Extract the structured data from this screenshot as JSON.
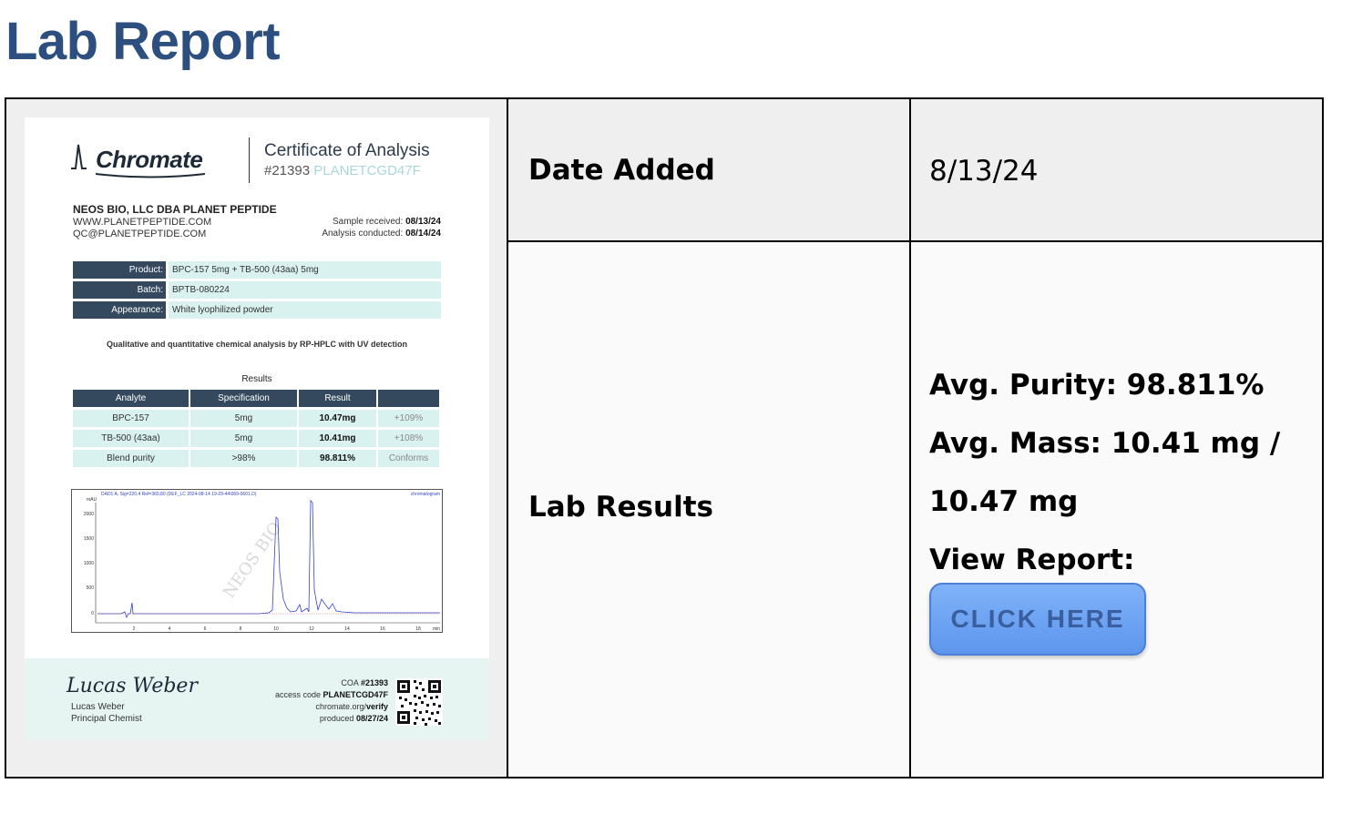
{
  "page": {
    "title": "Lab Report"
  },
  "table": {
    "date_added_label": "Date Added",
    "date_added_value": "8/13/24",
    "lab_results_label": "Lab Results",
    "avg_purity": "Avg. Purity: 98.811%",
    "avg_mass_line1": "Avg. Mass: 10.41 mg /",
    "avg_mass_line2": "10.47 mg",
    "view_report": "View Report:",
    "button_label": "CLICK HERE"
  },
  "coa": {
    "logo_text": "Chromate",
    "title": "Certificate of Analysis",
    "number": "#21393",
    "code": "PLANETCGD47F",
    "company": "NEOS BIO, LLC DBA PLANET PEPTIDE",
    "website": "WWW.PLANETPEPTIDE.COM",
    "email": "QC@PLANETPEPTIDE.COM",
    "received_label": "Sample received:",
    "received_date": "08/13/24",
    "conducted_label": "Analysis conducted:",
    "conducted_date": "08/14/24",
    "info": [
      {
        "key": "Product:",
        "value": "BPC-157 5mg + TB-500 (43aa) 5mg"
      },
      {
        "key": "Batch:",
        "value": "BPTB-080224"
      },
      {
        "key": "Appearance:",
        "value": "White lyophilized powder"
      }
    ],
    "method": "Qualitative and quantitative chemical analysis by RP-HPLC with UV detection",
    "results_title": "Results",
    "results_headers": [
      "Analyte",
      "Specification",
      "Result",
      ""
    ],
    "results_rows": [
      [
        "BPC-157",
        "5mg",
        "10.47mg",
        "+109%"
      ],
      [
        "TB-500 (43aa)",
        "5mg",
        "10.41mg",
        "+108%"
      ],
      [
        "Blend purity",
        ">98%",
        "98.811%",
        "Conforms"
      ]
    ],
    "chromatogram": {
      "header": "DAD1 A, Sig=220,4 Ref=360,80 (DEF_LC 2024-08-14 19-29-44\\069-0601.D)",
      "brand": "chromatogram",
      "unit_y": "mAU",
      "unit_x": "min",
      "y_ticks": [
        "2000",
        "1500",
        "1000",
        "500",
        "0"
      ],
      "x_ticks": [
        "2",
        "4",
        "6",
        "8",
        "10",
        "12",
        "14",
        "16",
        "18"
      ],
      "watermark": "NEOS BIO"
    },
    "signature": "Lucas Weber",
    "signer_name": "Lucas Weber",
    "signer_title": "Principal Chemist",
    "footer_coa_label": "COA",
    "footer_coa_number": "#21393",
    "footer_access_label": "access code",
    "footer_access_code": "PLANETCGD47F",
    "footer_verify_prefix": "chromate.org/",
    "footer_verify_path": "verify",
    "footer_produced_label": "produced",
    "footer_produced_date": "08/27/24"
  },
  "colors": {
    "title_blue": "#2c4f80",
    "header_navy": "#34495e",
    "cell_mint": "#d9f1ef",
    "button_blue": "#6fa4f2"
  }
}
